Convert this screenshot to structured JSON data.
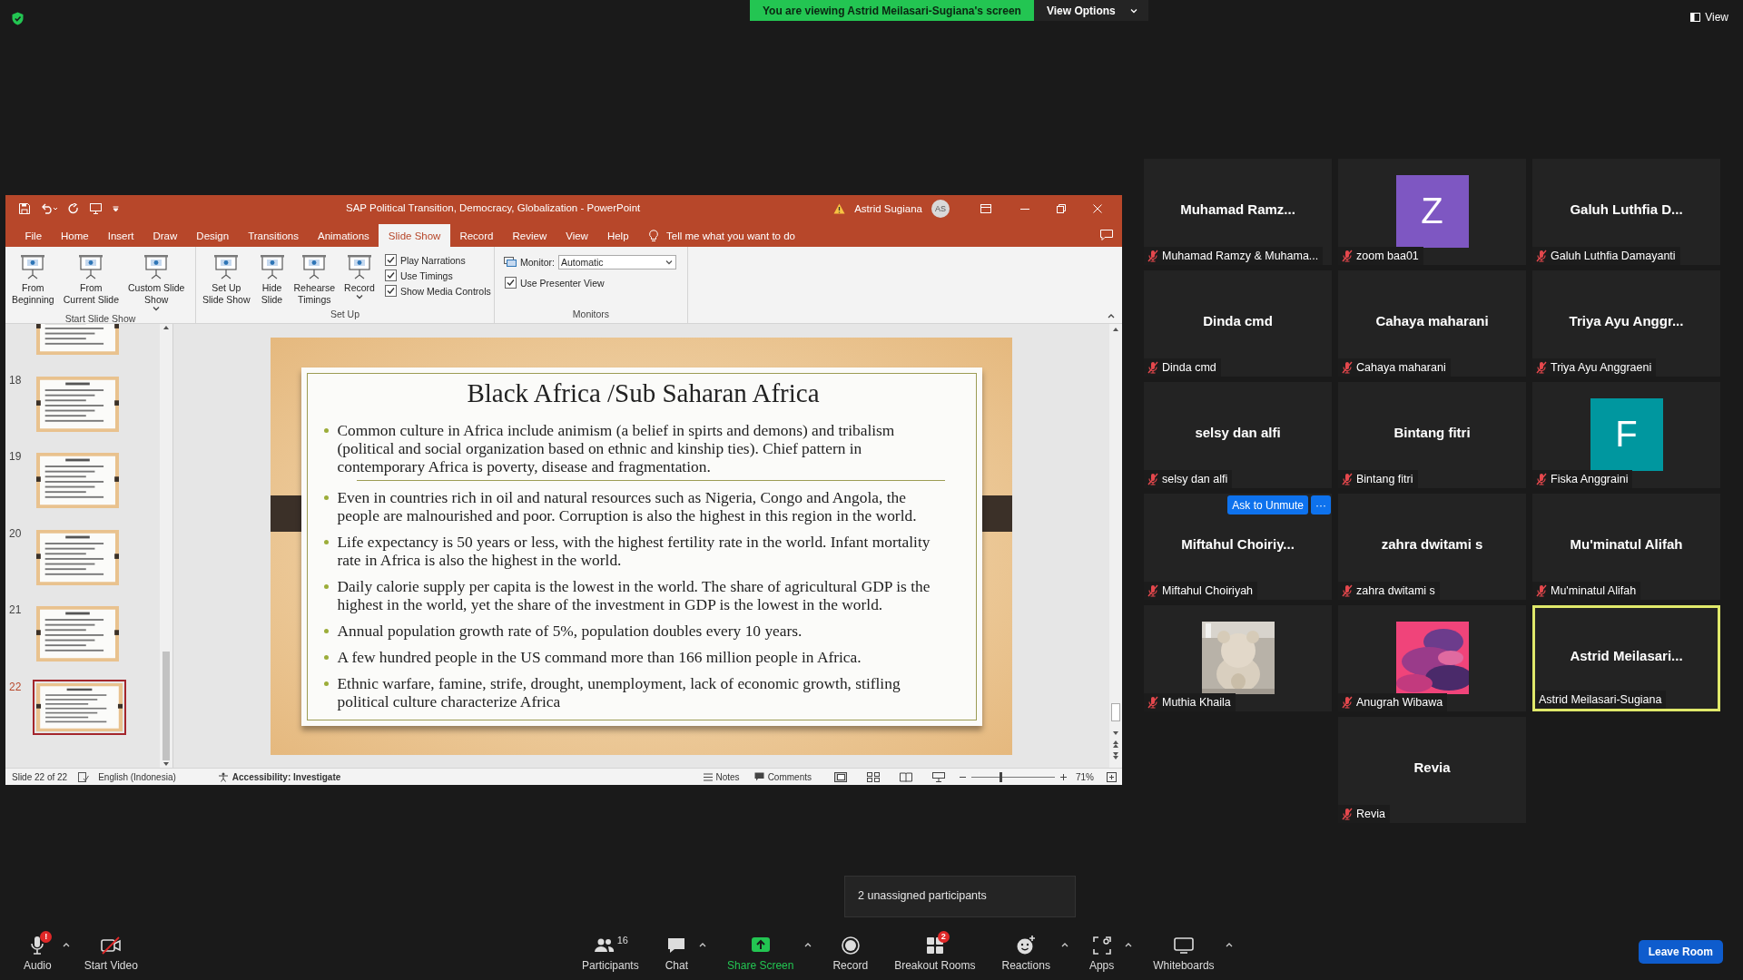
{
  "share_banner": {
    "text": "You are viewing Astrid Meilasari-Sugiana's screen",
    "view_options": "View Options"
  },
  "view_button": "View",
  "powerpoint": {
    "title": "SAP Political Transition, Democracy, Globalization  -  PowerPoint",
    "user_name": "Astrid Sugiana",
    "user_initials": "AS",
    "tabs": [
      {
        "label": "File",
        "selected": false
      },
      {
        "label": "Home",
        "selected": false
      },
      {
        "label": "Insert",
        "selected": false
      },
      {
        "label": "Draw",
        "selected": false
      },
      {
        "label": "Design",
        "selected": false
      },
      {
        "label": "Transitions",
        "selected": false
      },
      {
        "label": "Animations",
        "selected": false
      },
      {
        "label": "Slide Show",
        "selected": true
      },
      {
        "label": "Record",
        "selected": false
      },
      {
        "label": "Review",
        "selected": false
      },
      {
        "label": "View",
        "selected": false
      },
      {
        "label": "Help",
        "selected": false
      }
    ],
    "tell_me": "Tell me what you want to do",
    "ribbon": [
      {
        "label": "Start Slide Show",
        "items": [
          {
            "kind": "large",
            "label": "From\nBeginning",
            "dropdown": false
          },
          {
            "kind": "large",
            "label": "From\nCurrent Slide",
            "dropdown": false
          },
          {
            "kind": "large",
            "label": "Custom Slide\nShow",
            "dropdown": true
          }
        ]
      },
      {
        "label": "Set Up",
        "items": [
          {
            "kind": "large",
            "label": "Set Up\nSlide Show",
            "dropdown": false
          },
          {
            "kind": "large",
            "label": "Hide\nSlide",
            "dropdown": false
          },
          {
            "kind": "large",
            "label": "Rehearse\nTimings",
            "dropdown": false
          },
          {
            "kind": "large",
            "label": "Record",
            "dropdown": true
          },
          {
            "kind": "checks",
            "checks": [
              {
                "label": "Play Narrations",
                "checked": true
              },
              {
                "label": "Use Timings",
                "checked": true
              },
              {
                "label": "Show Media Controls",
                "checked": true
              }
            ]
          }
        ]
      },
      {
        "label": "Monitors",
        "items": [
          {
            "kind": "select",
            "label": "Monitor:",
            "value": "Automatic"
          },
          {
            "kind": "checks",
            "checks": [
              {
                "label": "Use Presenter View",
                "checked": true
              }
            ]
          }
        ]
      }
    ],
    "thumbnails": [
      {
        "selected": false
      },
      {
        "number": "18",
        "selected": false
      },
      {
        "number": "19",
        "selected": false
      },
      {
        "number": "20",
        "selected": false
      },
      {
        "number": "21",
        "selected": false
      },
      {
        "number": "22",
        "selected": true
      }
    ],
    "slide": {
      "title": "Black Africa /Sub Saharan Africa",
      "bullets": [
        "Common culture in Africa include animism (a belief in spirts and demons) and tribalism (political and social organization based on ethnic and kinship ties). Chief pattern in contemporary Africa is poverty, disease and fragmentation.",
        "Even in countries rich in oil and natural resources such as Nigeria, Congo and Angola, the people are malnourished and poor. Corruption is also the highest in this region in the world.",
        "Life expectancy is 50 years or less, with the highest fertility rate in the world. Infant mortality rate in Africa is also the highest in the world.",
        "Daily calorie supply per capita is the lowest in the world. The share of agricultural GDP is the highest in the world, yet the share of the investment in GDP is the lowest in the world.",
        "Annual population growth rate of 5%, population doubles every 10 years.",
        "A few hundred people in the US command more than 166 million people in Africa.",
        "Ethnic warfare, famine, strife, drought, unemployment, lack of economic growth, stifling political culture characterize Africa"
      ]
    },
    "status": {
      "slide": "Slide 22 of 22",
      "language": "English (Indonesia)",
      "accessibility": "Accessibility: Investigate",
      "notes": "Notes",
      "comments": "Comments",
      "zoom": "71%",
      "zoom_slider": {
        "level": 0.35
      }
    }
  },
  "participants": [
    {
      "title": "Muhamad Ramz...",
      "name": "Muhamad Ramzy & Muhama...",
      "muted": true,
      "active_speaker": false
    },
    {
      "avatar": {
        "kind": "letter",
        "letter": "Z",
        "color": "#7e57c2"
      },
      "name": "zoom baa01",
      "muted": true,
      "active_speaker": false
    },
    {
      "title": "Galuh Luthfia D...",
      "name": "Galuh Luthfia Damayanti",
      "muted": true,
      "active_speaker": false
    },
    {
      "title": "Dinda cmd",
      "name": "Dinda cmd",
      "muted": true,
      "active_speaker": false
    },
    {
      "title": "Cahaya maharani",
      "name": "Cahaya maharani",
      "muted": true,
      "active_speaker": false
    },
    {
      "title": "Triya Ayu Anggr...",
      "name": "Triya Ayu Anggraeni",
      "muted": true,
      "active_speaker": false
    },
    {
      "title": "selsy dan alfi",
      "name": "selsy dan alfi",
      "muted": true,
      "active_speaker": false
    },
    {
      "title": "Bintang fitri",
      "name": "Bintang fitri",
      "muted": true,
      "active_speaker": false
    },
    {
      "avatar": {
        "kind": "letter",
        "letter": "F",
        "color": "#00979f"
      },
      "name": "Fiska Anggraini",
      "muted": true,
      "active_speaker": false
    },
    {
      "title": "Miftahul Choiriy...",
      "name": "Miftahul Choiriyah",
      "muted": true,
      "active_speaker": false,
      "hover_controls": {
        "button": "Ask to Unmute",
        "more": "···"
      }
    },
    {
      "title": "zahra dwitami s",
      "name": "zahra dwitami s",
      "muted": true,
      "active_speaker": false
    },
    {
      "title": "Mu'minatul Alifah",
      "name": "Mu'minatul Alifah",
      "muted": true,
      "active_speaker": false
    },
    {
      "name": "Muthia Khaila",
      "muted": true,
      "active_speaker": false
    },
    {
      "name": "Anugrah Wibawa",
      "muted": true,
      "active_speaker": false
    },
    {
      "title": "Astrid Meilasari...",
      "name": "Astrid Meilasari-Sugiana",
      "muted": false,
      "active_speaker": true
    },
    {
      "title": "Revia",
      "name": "Revia",
      "muted": true,
      "active_speaker": false
    }
  ],
  "toolbar": {
    "items": [
      {
        "kind": "audio",
        "label": "Audio",
        "badge": "!",
        "caret": true
      },
      {
        "kind": "video",
        "label": "Start Video",
        "off": true,
        "caret": false
      },
      {
        "kind": "participants",
        "label": "Participants",
        "count": "16",
        "caret": false
      },
      {
        "kind": "chat",
        "label": "Chat",
        "caret": true
      },
      {
        "kind": "share",
        "label": "Share Screen",
        "caret": true
      },
      {
        "kind": "record",
        "label": "Record",
        "caret": false
      },
      {
        "kind": "breakout",
        "label": "Breakout Rooms",
        "badge": "2",
        "caret": false
      },
      {
        "kind": "reactions",
        "label": "Reactions",
        "caret": true
      },
      {
        "kind": "apps",
        "label": "Apps",
        "caret": true
      },
      {
        "kind": "whiteboards",
        "label": "Whiteboards",
        "caret": true
      }
    ],
    "leave": "Leave Room"
  },
  "tooltip": "2 unassigned participants"
}
